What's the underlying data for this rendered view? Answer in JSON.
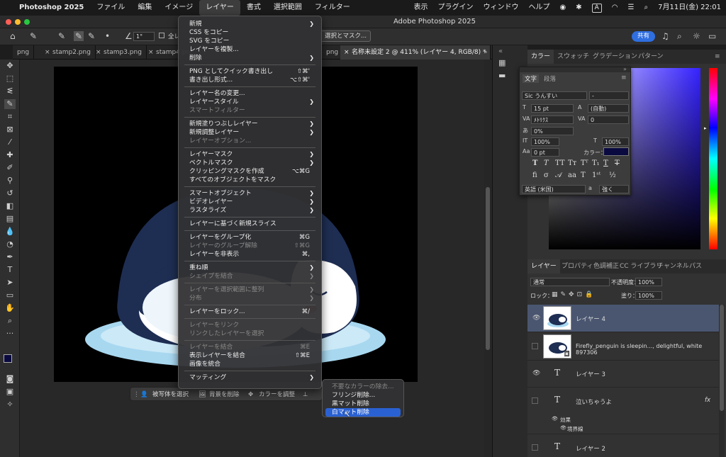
{
  "menubar": {
    "apple": "",
    "app": "Photoshop 2025",
    "items": [
      "ファイル",
      "編集",
      "イメージ",
      "レイヤー",
      "書式",
      "選択範囲",
      "フィルター"
    ],
    "right": [
      "表示",
      "プラグイン",
      "ウィンドウ",
      "ヘルプ"
    ],
    "input_method": "A",
    "datetime": "7月11日(金) 22:01"
  },
  "window": {
    "title": "Adobe Photoshop 2025"
  },
  "options": {
    "angle": "1°",
    "select_mask": "選択とマスク...",
    "share": "共有",
    "sample_all": "全レ"
  },
  "tabs": [
    {
      "label": "png"
    },
    {
      "label": "stamp2.png"
    },
    {
      "label": "stamp3.png"
    },
    {
      "label": "stamp4.pn"
    },
    {
      "label": "png"
    },
    {
      "label": "名称未設定 2 @ 411% (レイヤー 4, RGB/8) *"
    }
  ],
  "context_bar": {
    "select_subject": "被写体を選択",
    "remove_bg": "背景を削除",
    "adjust_color": "カラーを調整"
  },
  "layer_menu": [
    {
      "label": "新規",
      "arrow": true
    },
    {
      "label": "CSS をコピー"
    },
    {
      "label": "SVG をコピー"
    },
    {
      "label": "レイヤーを複製..."
    },
    {
      "label": "削除",
      "arrow": true
    },
    {
      "sep": true
    },
    {
      "label": "PNG としてクイック書き出し",
      "shortcut": "⇧⌘'"
    },
    {
      "label": "書き出し形式...",
      "shortcut": "⌥⇧⌘'"
    },
    {
      "sep": true
    },
    {
      "label": "レイヤー名の変更..."
    },
    {
      "label": "レイヤースタイル",
      "arrow": true
    },
    {
      "label": "スマートフィルター",
      "disabled": true
    },
    {
      "sep": true
    },
    {
      "label": "新規塗りつぶしレイヤー",
      "arrow": true
    },
    {
      "label": "新規調整レイヤー",
      "arrow": true
    },
    {
      "label": "レイヤーオプション...",
      "disabled": true
    },
    {
      "sep": true
    },
    {
      "label": "レイヤーマスク",
      "arrow": true
    },
    {
      "label": "ベクトルマスク",
      "arrow": true
    },
    {
      "label": "クリッピングマスクを作成",
      "shortcut": "⌥⌘G"
    },
    {
      "label": "すべてのオブジェクトをマスク"
    },
    {
      "sep": true
    },
    {
      "label": "スマートオブジェクト",
      "arrow": true
    },
    {
      "label": "ビデオレイヤー",
      "arrow": true
    },
    {
      "label": "ラスタライズ",
      "arrow": true
    },
    {
      "sep": true
    },
    {
      "label": "レイヤーに基づく新規スライス"
    },
    {
      "sep": true
    },
    {
      "label": "レイヤーをグループ化",
      "shortcut": "⌘G"
    },
    {
      "label": "レイヤーのグループ解除",
      "shortcut": "⇧⌘G",
      "disabled": true
    },
    {
      "label": "レイヤーを非表示",
      "shortcut": "⌘,"
    },
    {
      "sep": true
    },
    {
      "label": "重ね順",
      "arrow": true
    },
    {
      "label": "シェイプを結合",
      "arrow": true,
      "disabled": true
    },
    {
      "sep": true
    },
    {
      "label": "レイヤーを選択範囲に整列",
      "arrow": true,
      "disabled": true
    },
    {
      "label": "分布",
      "arrow": true,
      "disabled": true
    },
    {
      "sep": true
    },
    {
      "label": "レイヤーをロック...",
      "shortcut": "⌘/"
    },
    {
      "sep": true
    },
    {
      "label": "レイヤーをリンク",
      "disabled": true
    },
    {
      "label": "リンクしたレイヤーを選択",
      "disabled": true
    },
    {
      "sep": true
    },
    {
      "label": "レイヤーを結合",
      "shortcut": "⌘E",
      "disabled": true
    },
    {
      "label": "表示レイヤーを結合",
      "shortcut": "⇧⌘E"
    },
    {
      "label": "画像を統合"
    },
    {
      "sep": true
    },
    {
      "label": "マッティング",
      "arrow": true
    }
  ],
  "matting_submenu": [
    {
      "label": "不要なカラーの除去...",
      "disabled": true
    },
    {
      "label": "フリンジ削除..."
    },
    {
      "label": "黒マット削除"
    },
    {
      "label": "白マット削除",
      "highlighted": true
    }
  ],
  "panels": {
    "color_tabs": [
      "カラー",
      "スウォッチ",
      "グラデーション",
      "パターン"
    ],
    "char_tabs": [
      "文字",
      "段落"
    ],
    "layers_tabs": [
      "レイヤー",
      "プロパティ",
      "色調補正",
      "CC ライブラリ",
      "チャンネル",
      "パス"
    ]
  },
  "character": {
    "font": "Sic うんすい",
    "style": "-",
    "size": "15 pt",
    "leading": "(自動)",
    "kerning": "ﾒﾄﾘｸｽ",
    "tracking": "0",
    "tsume": "0%",
    "vscale": "100%",
    "hscale": "100%",
    "baseline": "0 pt",
    "color_label": "カラー：",
    "color": "#0a0a40",
    "language": "英語 (米国)",
    "antialias_label": "a",
    "antialias": "強く"
  },
  "layers": {
    "blend": "通常",
    "opacity_label": "不透明度：",
    "opacity": "100%",
    "lock_label": "ロック：",
    "fill_label": "塗り：",
    "fill": "100%",
    "rows": [
      {
        "name": "レイヤー 4"
      },
      {
        "name": "Firefly_penguin is sleepin..., delightful, white 897306"
      },
      {
        "name": "レイヤー 3"
      },
      {
        "name": "泣いちゃうよ",
        "fx": "fx"
      },
      {
        "name": "効果"
      },
      {
        "name": "境界線"
      },
      {
        "name": "レイヤー 2"
      }
    ]
  }
}
